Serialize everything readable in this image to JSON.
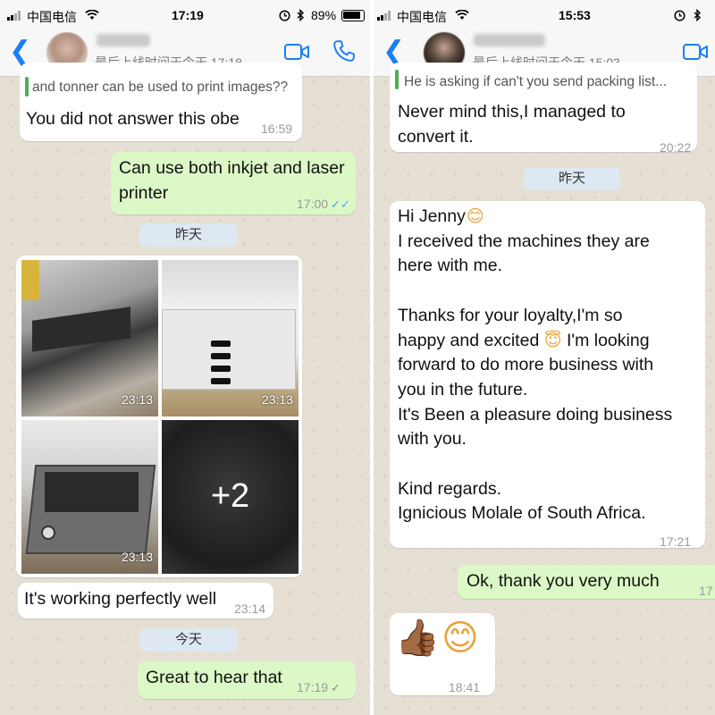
{
  "left": {
    "status": {
      "carrier": "中国电信",
      "time": "17:19",
      "battery": "89%"
    },
    "contact": {
      "name": "C",
      "last_seen": "最后上线时间于今天 17:18"
    },
    "quote_text": "and tonner can be used to print images??",
    "messages": [
      {
        "text": "You did not answer this obe",
        "time": "16:59"
      },
      {
        "lines": [
          "Can use both inkjet and laser",
          "printer"
        ],
        "time": "17:00",
        "ticks": "✓✓"
      },
      {
        "date": "昨天"
      },
      {
        "photos": [
          "23:13",
          "23:13",
          "23:13"
        ],
        "more": "+2"
      },
      {
        "text": "It's working perfectly well",
        "time": "23:14"
      },
      {
        "date": "今天"
      },
      {
        "text": "Great to hear that",
        "time": "17:19",
        "ticks": "✓"
      }
    ]
  },
  "right": {
    "status": {
      "carrier": "中国电信",
      "time": "15:53"
    },
    "contact": {
      "name": "",
      "last_seen": "最后上线时间于今天 15:03"
    },
    "quote_text": "He is asking if can't you send packing list...",
    "messages": [
      {
        "lines": [
          "Never mind this,I managed to",
          "convert it."
        ],
        "time": "20:22"
      },
      {
        "date": "昨天"
      },
      {
        "lines": [
          "Hi Jenny",
          "I received the machines they are",
          "here with me.",
          "",
          "Thanks for your loyalty,I'm so",
          "happy and excited",
          "I'm looking",
          "forward to do more business with",
          "you in the future.",
          "It's Been a pleasure doing business",
          "with you.",
          "",
          "Kind regards.",
          "Ignicious Molale of South Africa."
        ],
        "time": "17:21",
        "emoji_smile": "😊",
        "emoji_halo": "😇"
      },
      {
        "text": "Ok, thank you very much",
        "time": "17"
      },
      {
        "emoji_thumb": "👍🏾",
        "emoji_smile": "😊",
        "time": "18:41"
      }
    ]
  },
  "colors": {
    "accent": "#1a7ff5",
    "outgoing": "#dcf8c6",
    "incoming": "#ffffff",
    "read_ticks": "#4fa3f7"
  },
  "icons": [
    "back-chevron-icon",
    "video-call-icon",
    "phone-call-icon",
    "wifi-icon",
    "bluetooth-icon",
    "battery-icon",
    "alarm-lock-icon",
    "read-ticks-icon"
  ]
}
